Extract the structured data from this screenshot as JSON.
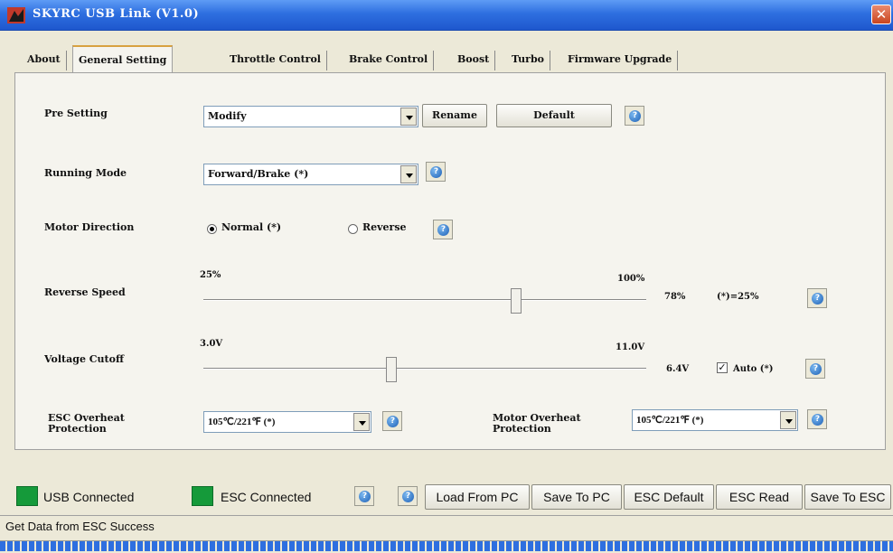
{
  "window": {
    "title": "SKYRC USB Link (V1.0)",
    "close": "✕"
  },
  "tabs": [
    {
      "label": "About"
    },
    {
      "label": "General Setting"
    },
    {
      "label": "Throttle Control"
    },
    {
      "label": "Brake Control"
    },
    {
      "label": "Boost"
    },
    {
      "label": "Turbo"
    },
    {
      "label": "Firmware Upgrade"
    }
  ],
  "active_tab": "General Setting",
  "settings": {
    "pre_setting": {
      "label": "Pre Setting",
      "value": "Modify",
      "rename": "Rename",
      "default": "Default"
    },
    "running_mode": {
      "label": "Running Mode",
      "value": "Forward/Brake (*)"
    },
    "motor_direction": {
      "label": "Motor Direction",
      "normal": "Normal (*)",
      "reverse": "Reverse",
      "selected": "Normal"
    },
    "reverse_speed": {
      "label": "Reverse Speed",
      "min": "25%",
      "max": "100%",
      "value": "78%",
      "default": "(*)=25%",
      "level": 0.707
    },
    "voltage_cutoff": {
      "label": "Voltage Cutoff",
      "min": "3.0V",
      "max": "11.0V",
      "value": "6.4V",
      "auto": "Auto (*)",
      "auto_checked": true,
      "level": 0.425
    },
    "esc_overheat": {
      "label_line1": "ESC Overheat",
      "label_line2": "Protection",
      "value": "105℃/221℉ (*)"
    },
    "motor_overheat": {
      "label_line1": "Motor Overheat",
      "label_line2": "Protection",
      "value": "105℃/221℉ (*)"
    }
  },
  "help_icon": "?",
  "status": {
    "usb": "USB Connected",
    "esc": "ESC Connected",
    "led_color": "#159A3A",
    "message": "Get Data from ESC Success"
  },
  "actions": {
    "load_from_pc": "Load From PC",
    "save_to_pc": "Save To PC",
    "esc_default": "ESC Default",
    "esc_read": "ESC Read",
    "save_to_esc": "Save To ESC"
  }
}
